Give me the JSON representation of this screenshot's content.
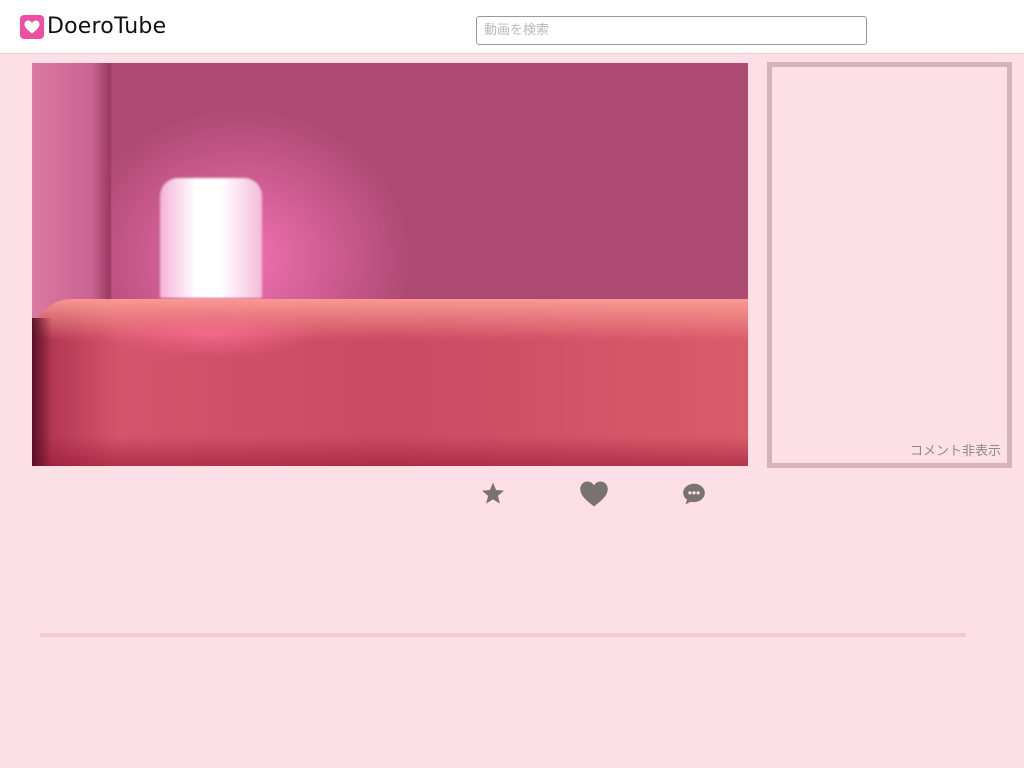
{
  "header": {
    "logo_text": "DoeroTube",
    "logo_icon": "heart-icon",
    "brand_color": "#ef4fa3"
  },
  "search": {
    "placeholder": "動画を検索",
    "value": ""
  },
  "comments": {
    "toggle_label": "コメント非表示"
  },
  "actions": {
    "favorite_icon": "star-icon",
    "like_icon": "heart-icon",
    "share_icon": "bubble-icon",
    "icon_color": "#7a7272"
  },
  "colors": {
    "page_background": "#fde0e5",
    "panel_border": "#d6b3bb"
  }
}
